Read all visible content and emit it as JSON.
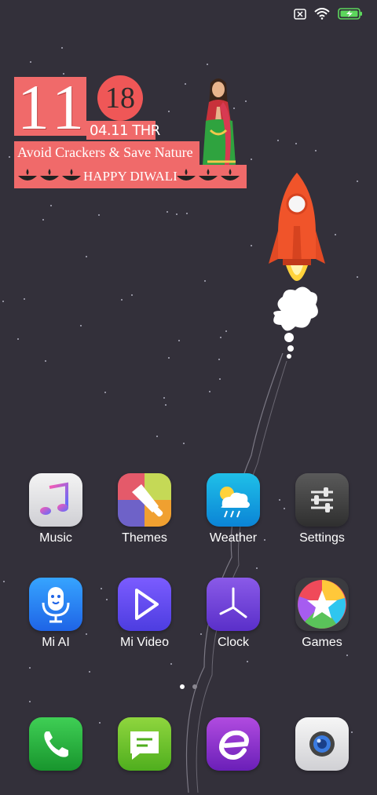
{
  "status_bar": {
    "icons": [
      "sim-off-icon",
      "wifi-icon",
      "battery-charging-icon"
    ],
    "battery_color": "#5cd65c"
  },
  "widget": {
    "hour": "11",
    "minute": "18",
    "date": "04.11 THR",
    "slogan": "Avoid Crackers & Save Nature",
    "greeting": "HAPPY DIWALI",
    "accent": "#f06a6a"
  },
  "apps": [
    {
      "label": "Music",
      "icon": "music-icon"
    },
    {
      "label": "Themes",
      "icon": "themes-icon"
    },
    {
      "label": "Weather",
      "icon": "weather-icon"
    },
    {
      "label": "Settings",
      "icon": "settings-icon"
    },
    {
      "label": "Mi AI",
      "icon": "mi-ai-icon"
    },
    {
      "label": "Mi Video",
      "icon": "mi-video-icon"
    },
    {
      "label": "Clock",
      "icon": "clock-icon"
    },
    {
      "label": "Games",
      "icon": "games-icon"
    }
  ],
  "page_indicator": {
    "pages": 2,
    "current": 1
  },
  "dock": [
    {
      "icon": "phone-icon"
    },
    {
      "icon": "messages-icon"
    },
    {
      "icon": "browser-icon"
    },
    {
      "icon": "camera-icon"
    }
  ]
}
